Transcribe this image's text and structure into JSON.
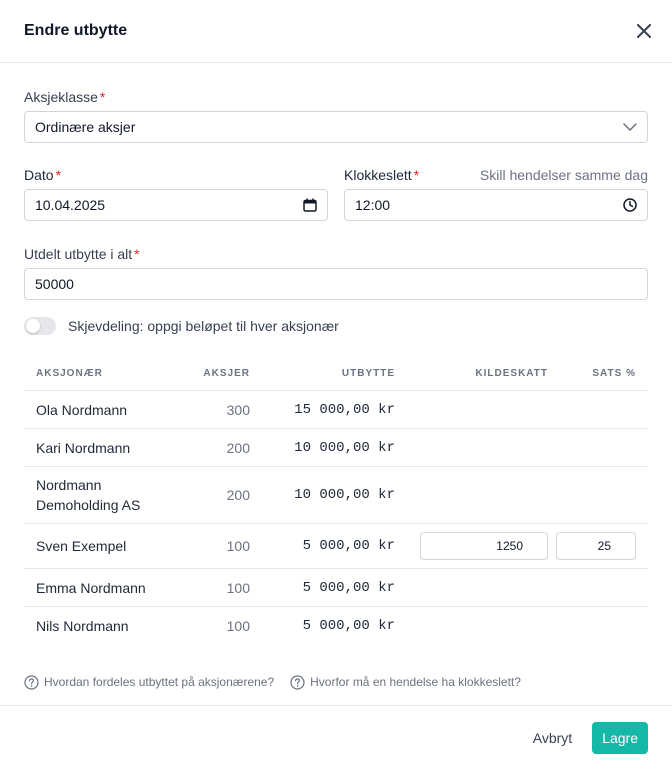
{
  "dialog": {
    "title": "Endre utbytte"
  },
  "form": {
    "share_class": {
      "label": "Aksjeklasse",
      "required_mark": "*",
      "value": "Ordinære aksjer"
    },
    "date": {
      "label": "Dato",
      "required_mark": "*",
      "value": "10.04.2025"
    },
    "time": {
      "label": "Klokkeslett",
      "required_mark": "*",
      "value": "12:00",
      "link": "Skill hendelser samme dag"
    },
    "total": {
      "label": "Utdelt utbytte i alt",
      "required_mark": "*",
      "value": "50000"
    },
    "skew_toggle": {
      "label": "Skjevdeling: oppgi beløpet til hver aksjonær",
      "checked": false
    }
  },
  "table": {
    "headers": [
      "AKSJONÆR",
      "AKSJER",
      "UTBYTTE",
      "KILDESKATT",
      "SATS %"
    ],
    "rows": [
      {
        "name": "Ola Nordmann",
        "shares": "300",
        "dividend": "15 000,00 kr",
        "withholding": "",
        "rate": ""
      },
      {
        "name": "Kari Nordmann",
        "shares": "200",
        "dividend": "10 000,00 kr",
        "withholding": "",
        "rate": ""
      },
      {
        "name": "Nordmann Demoholding AS",
        "shares": "200",
        "dividend": "10 000,00 kr",
        "withholding": "",
        "rate": ""
      },
      {
        "name": "Sven Exempel",
        "shares": "100",
        "dividend": "5 000,00 kr",
        "withholding": "1250",
        "rate": "25"
      },
      {
        "name": "Emma Nordmann",
        "shares": "100",
        "dividend": "5 000,00 kr",
        "withholding": "",
        "rate": ""
      },
      {
        "name": "Nils Nordmann",
        "shares": "100",
        "dividend": "5 000,00 kr",
        "withholding": "",
        "rate": ""
      }
    ]
  },
  "help": {
    "distribution": "Hvordan fordeles utbyttet på aksjonærene?",
    "time_reason": "Hvorfor må en hendelse ha klokkeslett?"
  },
  "footer": {
    "cancel_label": "Avbryt",
    "save_label": "Lagre"
  },
  "colors": {
    "primary": "#14b8a6",
    "required": "#dc2626",
    "border": "#d1d5db"
  },
  "icons": [
    "close-icon",
    "chevron-down-icon",
    "calendar-icon",
    "clock-icon",
    "help-circle-icon"
  ]
}
